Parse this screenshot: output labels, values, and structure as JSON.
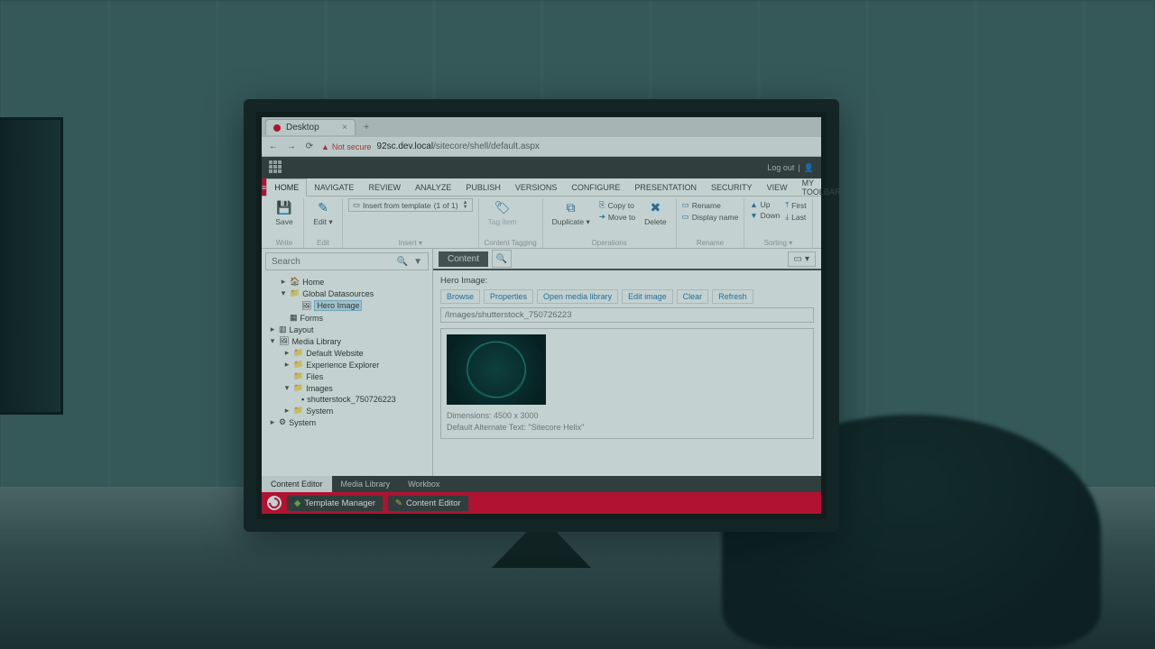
{
  "browser": {
    "tab_title": "Desktop",
    "not_secure": "Not secure",
    "url_host": "92sc.dev.local",
    "url_path": "/sitecore/shell/default.aspx"
  },
  "brandbar": {
    "logout": "Log out"
  },
  "ribbon_tabs": {
    "home": "HOME",
    "navigate": "NAVIGATE",
    "review": "REVIEW",
    "analyze": "ANALYZE",
    "publish": "PUBLISH",
    "versions": "VERSIONS",
    "configure": "CONFIGURE",
    "presentation": "PRESENTATION",
    "security": "SECURITY",
    "view": "VIEW",
    "mytoolbar": "MY TOOLBAR"
  },
  "ribbon": {
    "save": "Save",
    "edit": "Edit",
    "write": "Write",
    "edit_group": "Edit",
    "insert_from_template": "Insert from template",
    "insert_count": "(1 of 1)",
    "insert_group": "Insert",
    "tag_item": "Tag item",
    "content_tagging": "Content Tagging",
    "duplicate": "Duplicate",
    "copy_to": "Copy to",
    "move_to": "Move to",
    "delete": "Delete",
    "operations": "Operations",
    "rename": "Rename",
    "display_name": "Display name",
    "rename_group": "Rename",
    "up": "Up",
    "down": "Down",
    "first": "First",
    "last": "Last",
    "sorting": "Sorting"
  },
  "search": {
    "placeholder": "Search"
  },
  "tree": {
    "home": "Home",
    "global_datasources": "Global Datasources",
    "hero_image": "Hero Image",
    "forms": "Forms",
    "layout": "Layout",
    "media_library": "Media Library",
    "default_website": "Default Website",
    "experience_explorer": "Experience Explorer",
    "files": "Files",
    "images": "Images",
    "shutterstock": "shutterstock_750726223",
    "system1": "System",
    "system2": "System"
  },
  "content": {
    "tab": "Content",
    "field_label": "Hero Image:",
    "btn_browse": "Browse",
    "btn_properties": "Properties",
    "btn_open_media": "Open media library",
    "btn_edit_image": "Edit image",
    "btn_clear": "Clear",
    "btn_refresh": "Refresh",
    "image_path": "/Images/shutterstock_750726223",
    "dimensions": "Dimensions: 4500 x 3000",
    "alt_text": "Default Alternate Text: \"Sitecore Helix\""
  },
  "bottom_tabs": {
    "content_editor": "Content Editor",
    "media_library": "Media Library",
    "workbox": "Workbox"
  },
  "taskbar": {
    "template_manager": "Template Manager",
    "content_editor": "Content Editor"
  }
}
